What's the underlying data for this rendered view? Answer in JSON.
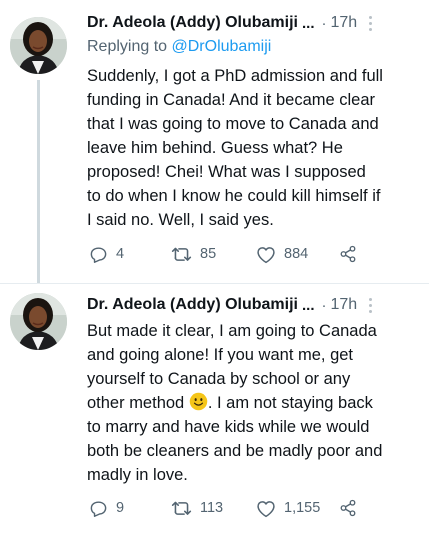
{
  "tweets": [
    {
      "author_name": "Dr. Adeola (Addy) Olubamiji",
      "truncation": "...",
      "separator": "·",
      "time": "17h",
      "replying_prefix": "Replying to",
      "replying_handle": "@DrOlubamiji",
      "text_lines": [
        "Suddenly, I got a PhD admission and full",
        "funding in Canada! And it became clear",
        "that I was going to move to Canada and",
        "leave him behind. Guess what? He",
        "proposed! Chei! What was I supposed",
        "to do when I know he could kill himself if",
        "I said no. Well, I said yes."
      ],
      "replies": "4",
      "retweets": "85",
      "likes": "884"
    },
    {
      "author_name": "Dr. Adeola (Addy) Olubamiji",
      "truncation": "...",
      "separator": "·",
      "time": "17h",
      "text_lines": [
        "But made it clear, I am going to Canada",
        "and going alone! If you want me, get",
        "yourself to Canada by school or any",
        "other method",
        ". I am not staying back",
        "to marry and have kids while we would",
        "both be cleaners and be madly poor and",
        "madly in love."
      ],
      "emoji": "slightly-smiling-face",
      "replies": "9",
      "retweets": "113",
      "likes": "1,155"
    }
  ],
  "colors": {
    "text": "#0f1419",
    "muted": "#536471",
    "link": "#1d9bf0",
    "thread_line": "#cfd9de",
    "emoji": "#f5c518"
  },
  "icons": [
    "reply-icon",
    "retweet-icon",
    "like-icon",
    "share-icon",
    "more-options-icon"
  ]
}
